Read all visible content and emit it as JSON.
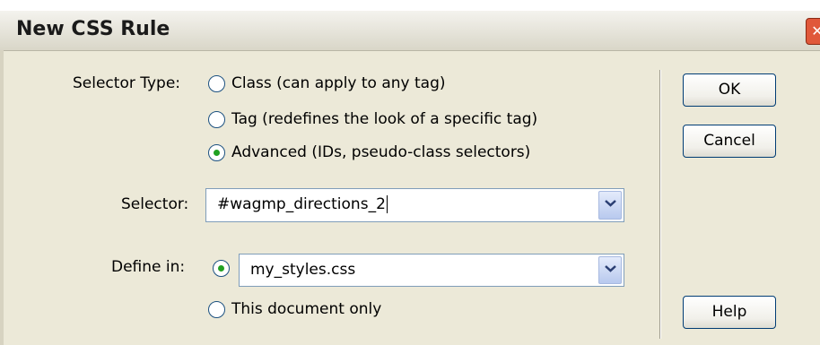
{
  "dialog": {
    "title": "New CSS Rule",
    "close_symbol": "✕"
  },
  "selector_type": {
    "label": "Selector Type:",
    "options": [
      {
        "label": "Class (can apply to any tag)",
        "checked": false
      },
      {
        "label": "Tag (redefines the look of a specific tag)",
        "checked": false
      },
      {
        "label": "Advanced (IDs, pseudo-class selectors)",
        "checked": true
      }
    ]
  },
  "selector": {
    "label": "Selector:",
    "value": "#wagmp_directions_2"
  },
  "define_in": {
    "label": "Define in:",
    "file_value": "my_styles.css",
    "file_checked": true,
    "document_only_label": "This document only",
    "document_only_checked": false
  },
  "buttons": {
    "ok": "OK",
    "cancel": "Cancel",
    "help": "Help"
  }
}
